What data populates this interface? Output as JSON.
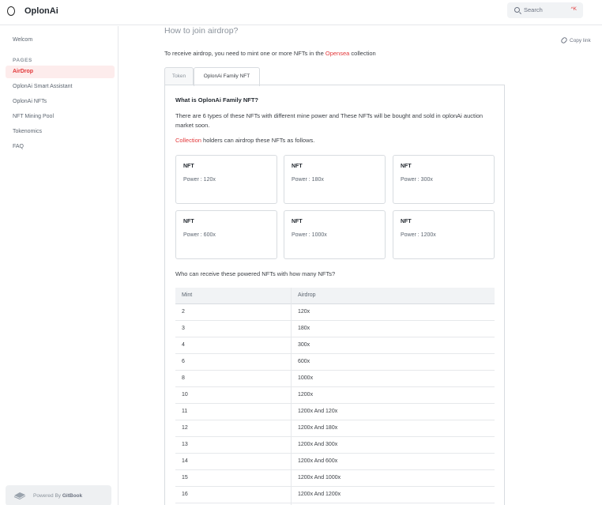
{
  "app": {
    "title": "OplonAi"
  },
  "search": {
    "placeholder": "Search",
    "shortcut": "^K"
  },
  "sidebar": {
    "top_item": "Welcom",
    "section_label": "PAGES",
    "items": [
      {
        "label": "AirDrop",
        "active": true
      },
      {
        "label": "OplonAi Smart Assistant",
        "active": false
      },
      {
        "label": "OplonAi NFTs",
        "active": false
      },
      {
        "label": "NFT Mining Pool",
        "active": false
      },
      {
        "label": "Tokenomics",
        "active": false
      },
      {
        "label": "FAQ",
        "active": false
      }
    ],
    "powered_prefix": "Powered By",
    "powered_brand": "GitBook"
  },
  "main": {
    "title": "How to join airdrop?",
    "copy_link": "Copy link",
    "intro_before": "To receive airdrop, you need to mint one or more NFTs in the",
    "intro_link": "Opensea",
    "intro_after": "collection",
    "tabs": [
      {
        "label": "Token",
        "active": false
      },
      {
        "label": "OplonAi Family NFT",
        "active": true
      }
    ],
    "panel": {
      "heading": "What is OplonAi Family NFT?",
      "paragraph": "There are 6 types of these NFTs with different mine power and These NFTs will be bought and sold in oplonAi auction market soon.",
      "collection_link": "Collection",
      "collection_after": "holders can airdrop these NFTs as follows.",
      "cards": [
        {
          "title": "NFT",
          "power": "Power : 120x"
        },
        {
          "title": "NFT",
          "power": "Power : 180x"
        },
        {
          "title": "NFT",
          "power": "Power : 300x"
        },
        {
          "title": "NFT",
          "power": "Power : 600x"
        },
        {
          "title": "NFT",
          "power": "Power : 1000x"
        },
        {
          "title": "NFT",
          "power": "Power : 1200x"
        }
      ],
      "question": "Who can receive these powered NFTs with how many NFTs?",
      "table": {
        "headers": [
          "Mint",
          "Airdrop"
        ],
        "rows": [
          [
            "2",
            "120x"
          ],
          [
            "3",
            "180x"
          ],
          [
            "4",
            "300x"
          ],
          [
            "6",
            "600x"
          ],
          [
            "8",
            "1000x"
          ],
          [
            "10",
            "1200x"
          ],
          [
            "11",
            "1200x And 120x"
          ],
          [
            "12",
            "1200x And 180x"
          ],
          [
            "13",
            "1200x And 300x"
          ],
          [
            "14",
            "1200x And 600x"
          ],
          [
            "15",
            "1200x And 1000x"
          ],
          [
            "16",
            "1200x And 1200x"
          ]
        ]
      }
    }
  }
}
